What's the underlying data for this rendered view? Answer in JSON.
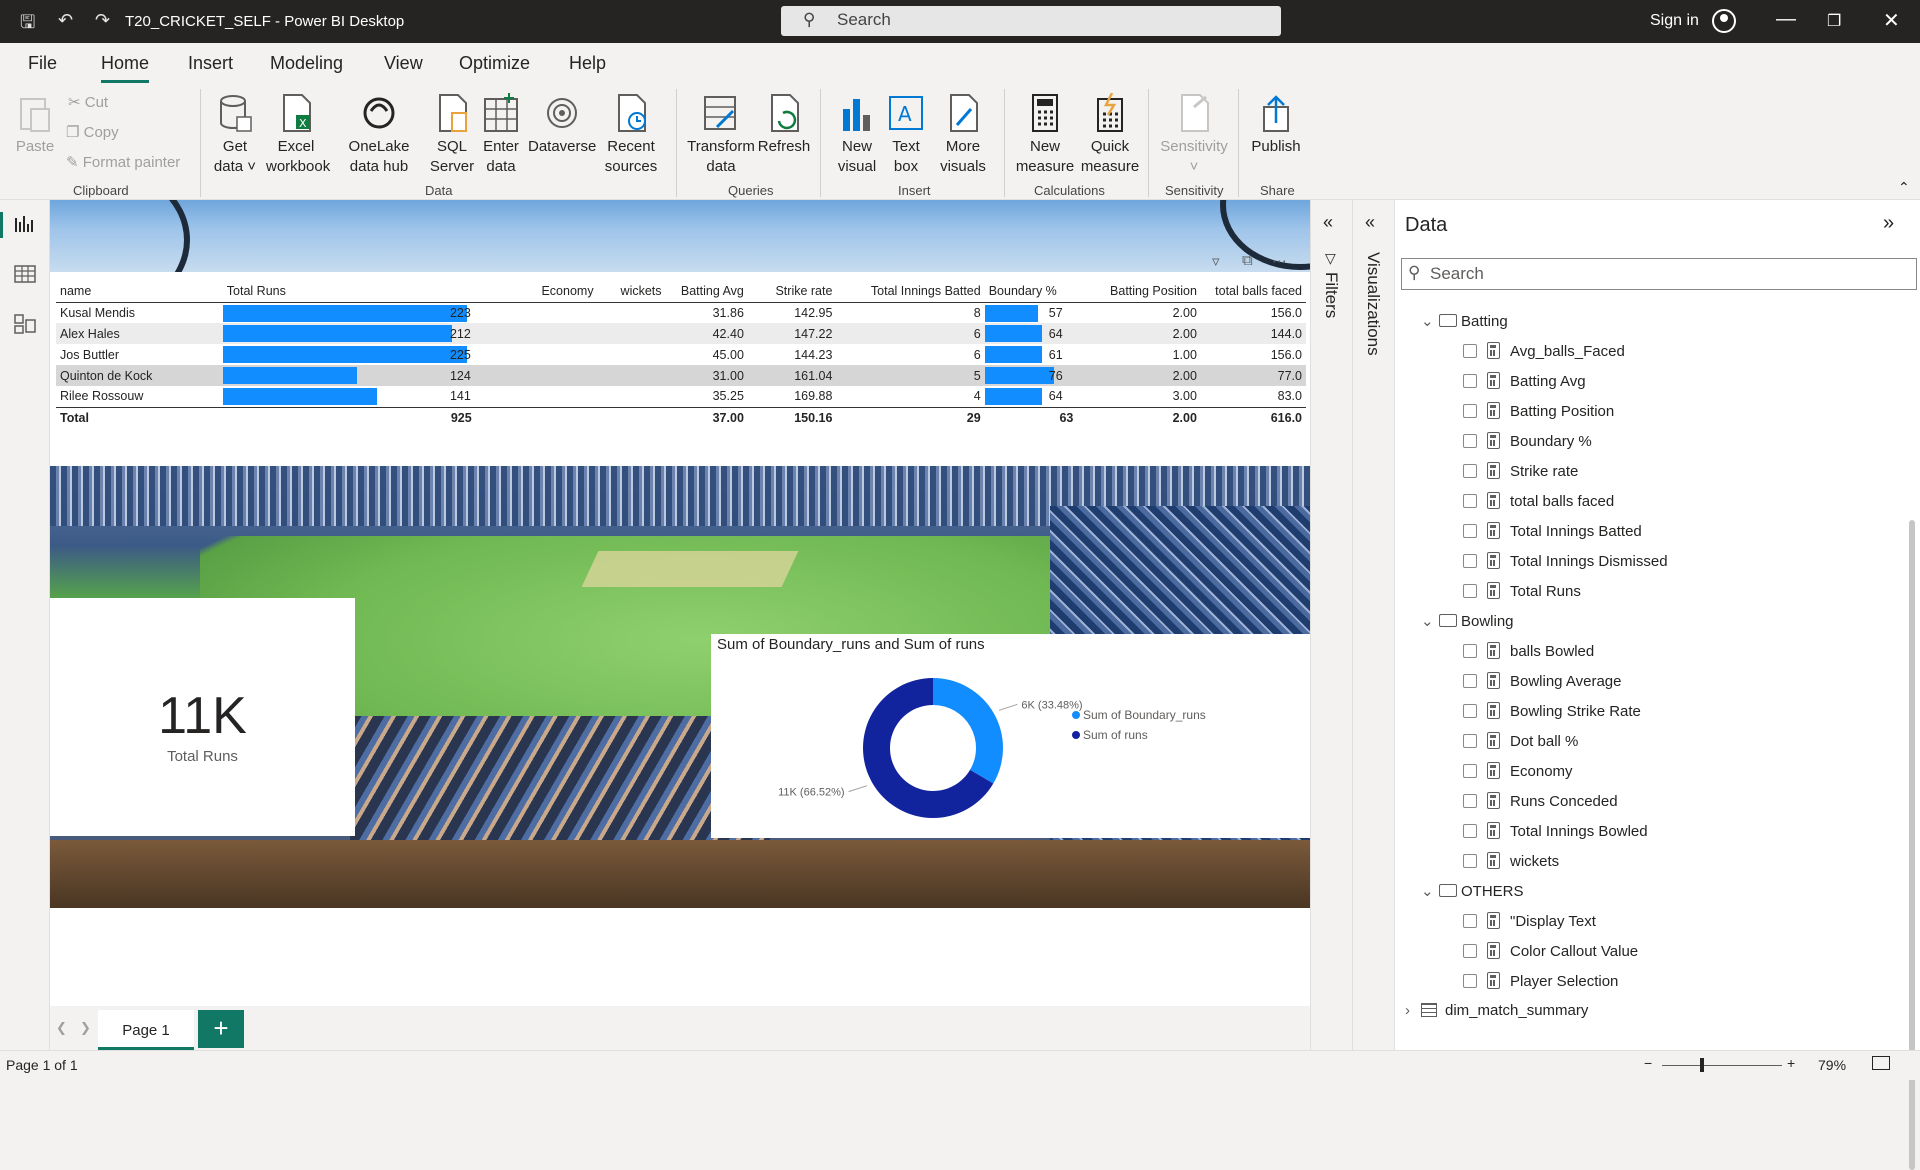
{
  "titlebar": {
    "title": "T20_CRICKET_SELF - Power BI Desktop",
    "search_placeholder": "Search",
    "signin": "Sign in"
  },
  "menu": {
    "items": [
      "File",
      "Home",
      "Insert",
      "Modeling",
      "View",
      "Optimize",
      "Help"
    ],
    "active": "Home"
  },
  "ribbon": {
    "clipboard": {
      "paste": "Paste",
      "cut": "Cut",
      "copy": "Copy",
      "format_painter": "Format painter",
      "group": "Clipboard"
    },
    "data": {
      "get_data": "Get data",
      "excel": "Excel workbook",
      "onelake": "OneLake data hub",
      "sql": "SQL Server",
      "enter": "Enter data",
      "dataverse": "Dataverse",
      "recent": "Recent sources",
      "group": "Data"
    },
    "queries": {
      "transform": "Transform data",
      "refresh": "Refresh",
      "group": "Queries"
    },
    "insert": {
      "new_visual": "New visual",
      "text_box": "Text box",
      "more_visuals": "More visuals",
      "group": "Insert"
    },
    "calculations": {
      "new_measure": "New measure",
      "quick_measure": "Quick measure",
      "group": "Calculations"
    },
    "sensitivity": {
      "label": "Sensitivity",
      "group": "Sensitivity"
    },
    "share": {
      "publish": "Publish",
      "group": "Share"
    }
  },
  "table": {
    "headers": [
      "name",
      "Total Runs",
      "Economy",
      "wickets",
      "Batting Avg",
      "Strike rate",
      "Total Innings Batted",
      "Boundary %",
      "Batting Position",
      "total balls faced"
    ],
    "rows": [
      {
        "name": "Kusal Mendis",
        "total_runs": "223",
        "economy": "",
        "wickets": "",
        "batting_avg": "31.86",
        "strike_rate": "142.95",
        "innings": "8",
        "boundary_pct": "57",
        "batting_pos": "2.00",
        "balls_faced": "156.0",
        "runs_frac": 1.0,
        "boundary_frac": 0.72
      },
      {
        "name": "Alex Hales",
        "total_runs": "212",
        "economy": "",
        "wickets": "",
        "batting_avg": "42.40",
        "strike_rate": "147.22",
        "innings": "6",
        "boundary_pct": "64",
        "batting_pos": "2.00",
        "balls_faced": "144.0",
        "runs_frac": 0.94,
        "boundary_frac": 0.78
      },
      {
        "name": "Jos Buttler",
        "total_runs": "225",
        "economy": "",
        "wickets": "",
        "batting_avg": "45.00",
        "strike_rate": "144.23",
        "innings": "6",
        "boundary_pct": "61",
        "batting_pos": "1.00",
        "balls_faced": "156.0",
        "runs_frac": 1.0,
        "boundary_frac": 0.78
      },
      {
        "name": "Quinton de Kock",
        "total_runs": "124",
        "economy": "",
        "wickets": "",
        "batting_avg": "31.00",
        "strike_rate": "161.04",
        "innings": "5",
        "boundary_pct": "76",
        "batting_pos": "2.00",
        "balls_faced": "77.0",
        "runs_frac": 0.55,
        "boundary_frac": 0.94
      },
      {
        "name": "Rilee Rossouw",
        "total_runs": "141",
        "economy": "",
        "wickets": "",
        "batting_avg": "35.25",
        "strike_rate": "169.88",
        "innings": "4",
        "boundary_pct": "64",
        "batting_pos": "3.00",
        "balls_faced": "83.0",
        "runs_frac": 0.63,
        "boundary_frac": 0.78
      }
    ],
    "total": {
      "name": "Total",
      "total_runs": "925",
      "economy": "",
      "wickets": "",
      "batting_avg": "37.00",
      "strike_rate": "150.16",
      "innings": "29",
      "boundary_pct": "63",
      "batting_pos": "2.00",
      "balls_faced": "616.0"
    }
  },
  "kpi": {
    "value": "11K",
    "label": "Total Runs"
  },
  "chart_data": {
    "type": "pie",
    "title": "Sum of Boundary_runs and Sum of runs",
    "slices": [
      {
        "name": "Sum of Boundary_runs",
        "label": "6K (33.48%)",
        "percent": 33.48,
        "color": "#118dff"
      },
      {
        "name": "Sum of runs",
        "label": "11K (66.52%)",
        "percent": 66.52,
        "color": "#12239e"
      }
    ],
    "legend_position": "right"
  },
  "pages": {
    "tab": "Page 1",
    "add": "+"
  },
  "status": {
    "page": "Page 1 of 1",
    "zoom": "79%"
  },
  "panes": {
    "filters": "Filters",
    "visualizations": "Visualizations"
  },
  "datapane": {
    "title": "Data",
    "search_placeholder": "Search",
    "folders": [
      {
        "name": "Batting",
        "fields": [
          "Avg_balls_Faced",
          "Batting Avg",
          "Batting Position",
          "Boundary %",
          "Strike rate",
          "total balls faced",
          "Total Innings Batted",
          "Total Innings Dismissed",
          "Total Runs"
        ]
      },
      {
        "name": "Bowling",
        "fields": [
          "balls Bowled",
          "Bowling Average",
          "Bowling Strike Rate",
          "Dot ball %",
          "Economy",
          "Runs Conceded",
          "Total Innings Bowled",
          "wickets"
        ]
      },
      {
        "name": "OTHERS",
        "fields": [
          "\"Display Text",
          "Color Callout Value",
          "Player Selection"
        ]
      }
    ],
    "table": "dim_match_summary"
  },
  "colors": {
    "accent": "#117865",
    "bar": "#118dff",
    "dark_series": "#12239e"
  }
}
